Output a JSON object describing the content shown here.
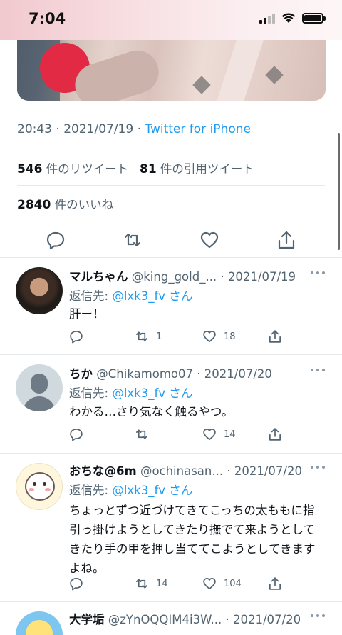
{
  "status_bar": {
    "time": "7:04"
  },
  "tweet": {
    "timestamp": "20:43 · 2021/07/19 · ",
    "client": "Twitter for iPhone",
    "retweets_count": "546",
    "retweets_label": "件のリツイート",
    "quotes_count": "81",
    "quotes_label": "件の引用ツイート",
    "likes_count": "2840",
    "likes_label": "件のいいね"
  },
  "replies": [
    {
      "name": "マルちゃん",
      "handle": "@king_gold_...",
      "date": "2021/07/19",
      "reply_to_label": "返信先: ",
      "reply_to_handle": "@lxk3_fv",
      "reply_to_suffix": " さん",
      "text": "肝ー！",
      "retweets": "1",
      "likes": "18"
    },
    {
      "name": "ちか",
      "handle": "@Chikamomo07",
      "date": "2021/07/20",
      "reply_to_label": "返信先: ",
      "reply_to_handle": "@lxk3_fv",
      "reply_to_suffix": " さん",
      "text": "わかる…さり気なく触るやつ。",
      "retweets": "",
      "likes": "14"
    },
    {
      "name": "おちな@6m",
      "handle": "@ochinasan...",
      "date": "2021/07/20",
      "reply_to_label": "返信先: ",
      "reply_to_handle": "@lxk3_fv",
      "reply_to_suffix": " さん",
      "text": "ちょっとずつ近づけてきてこっちの太ももに指引っ掛けようとしてきたり撫でて来ようとしてきたり手の甲を押し当ててこようとしてきますよね。",
      "retweets": "14",
      "likes": "104"
    },
    {
      "name": "大学垢",
      "handle": "@zYnOQQIM4i3W...",
      "date": "2021/07/20"
    }
  ],
  "icons": [
    "reply-icon",
    "retweet-icon",
    "like-icon",
    "share-icon",
    "more-icon"
  ],
  "colors": {
    "link": "#1d9bf0",
    "secondary": "#536471",
    "divider": "#e6e9eb"
  }
}
